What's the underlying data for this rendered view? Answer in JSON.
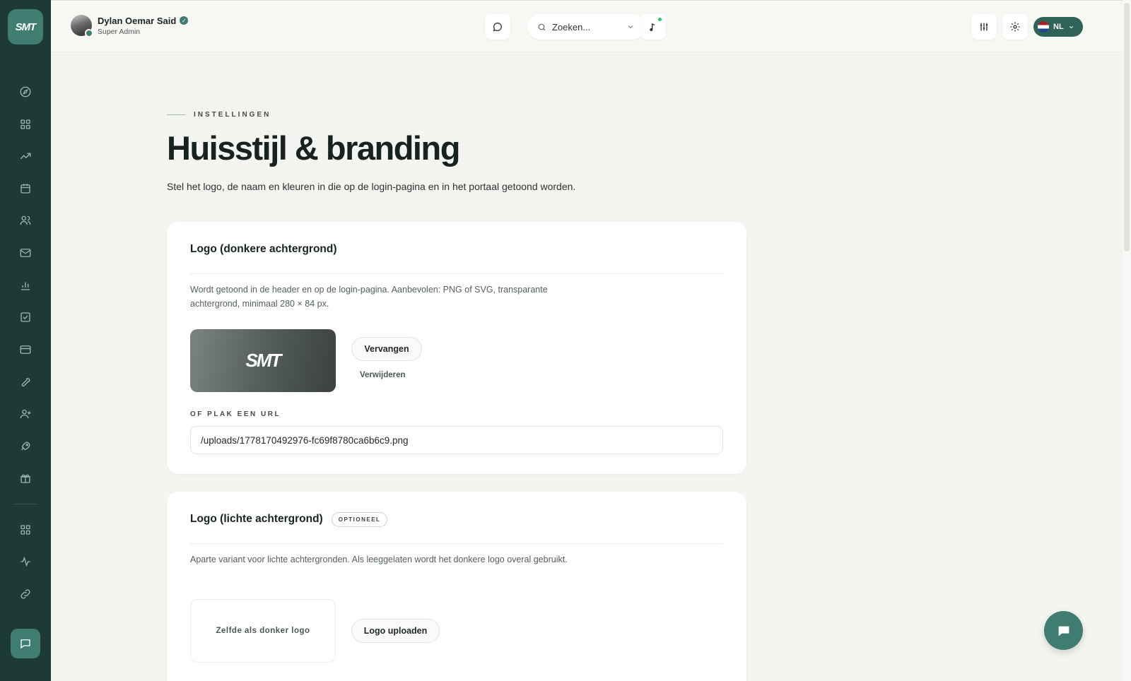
{
  "sidebar": {
    "brand": "SMT",
    "items": [
      {
        "icon": "compass-icon"
      },
      {
        "icon": "grid-icon"
      },
      {
        "icon": "trending-icon"
      },
      {
        "icon": "calendar-icon"
      },
      {
        "icon": "users-icon"
      },
      {
        "icon": "mail-icon"
      },
      {
        "icon": "bar-chart-icon"
      },
      {
        "icon": "check-square-icon"
      },
      {
        "icon": "credit-card-icon"
      },
      {
        "icon": "wrench-icon"
      },
      {
        "icon": "user-plus-icon"
      },
      {
        "icon": "rocket-icon"
      },
      {
        "icon": "gift-icon"
      }
    ],
    "bottom_items": [
      {
        "icon": "apps-icon"
      },
      {
        "icon": "activity-icon"
      },
      {
        "icon": "link-icon"
      }
    ]
  },
  "header": {
    "user_name": "Dylan Oemar Said",
    "user_role": "Super Admin",
    "search_placeholder": "Zoeken...",
    "lang": "NL"
  },
  "page": {
    "eyebrow": "INSTELLINGEN",
    "title": "Huisstijl & branding",
    "subtitle": "Stel het logo, de naam en kleuren in die op de login-pagina en in het portaal getoond worden."
  },
  "card_dark": {
    "title": "Logo (donkere achtergrond)",
    "description": "Wordt getoond in de header en op de login-pagina. Aanbevolen: PNG of SVG, transparante achtergrond, minimaal 280 × 84 px.",
    "logo_text": "SMT",
    "replace_label": "Vervangen",
    "remove_label": "Verwijderen",
    "url_label": "OF PLAK EEN URL",
    "url_value": "/uploads/1778170492976-fc69f8780ca6b6c9.png"
  },
  "card_light": {
    "title": "Logo (lichte achtergrond)",
    "badge": "OPTIONEEL",
    "description": "Aparte variant voor lichte achtergronden. Als leeggelaten wordt het donkere logo overal gebruikt.",
    "empty_text": "Zelfde als donker logo",
    "upload_label": "Logo uploaden"
  },
  "colors": {
    "sidebar_bg": "#1d3a35",
    "accent": "#3e7d70"
  }
}
